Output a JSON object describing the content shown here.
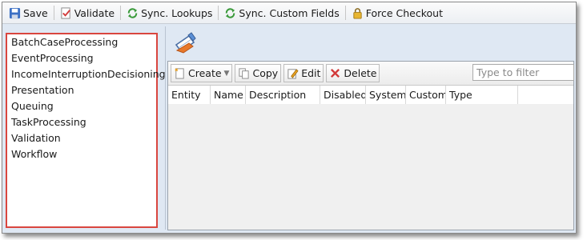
{
  "toolbar": {
    "save": "Save",
    "validate": "Validate",
    "sync_lookups": "Sync. Lookups",
    "sync_custom_fields": "Sync. Custom Fields",
    "force_checkout": "Force Checkout"
  },
  "tree": {
    "items": [
      "BatchCaseProcessing",
      "EventProcessing",
      "IncomeInterruptionDecisioning",
      "Presentation",
      "Queuing",
      "TaskProcessing",
      "Validation",
      "Workflow"
    ]
  },
  "list_toolbar": {
    "create": "Create",
    "copy": "Copy",
    "edit": "Edit",
    "delete": "Delete",
    "filter_placeholder": "Type to filter"
  },
  "grid": {
    "columns": [
      "Entity",
      "Name",
      "Description",
      "Disabled",
      "System",
      "Custom",
      "Type"
    ]
  },
  "colors": {
    "accent": "#d9463f",
    "window_bg": "#dfe8f3"
  }
}
